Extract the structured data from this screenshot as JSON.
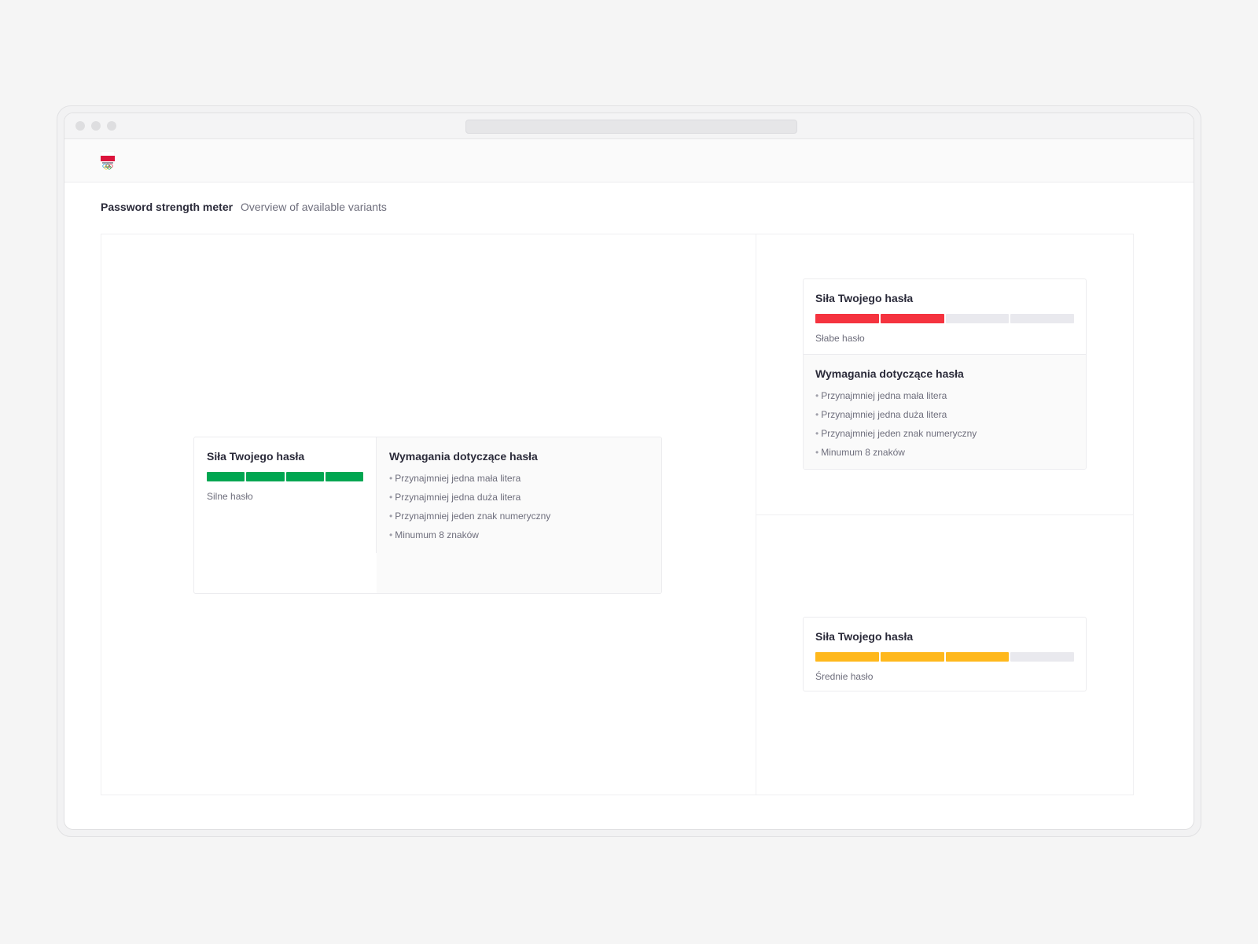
{
  "page": {
    "title": "Password strength meter",
    "subtitle": "Overview of available variants"
  },
  "logo": {
    "icon": "poland-olympic-logo"
  },
  "colors": {
    "strong": "#00a651",
    "weak": "#f5333f",
    "medium": "#ffb81c",
    "empty": "#e9e9ee"
  },
  "variants": {
    "horizontal": {
      "title": "Siła Twojego hasła",
      "strength_label": "Silne hasło",
      "strength_level": 4,
      "strength_max": 4,
      "level_color": "strong",
      "requirements_title": "Wymagania dotyczące hasła",
      "requirements": [
        "Przynajmniej jedna mała litera",
        "Przynajmniej jedna duża litera",
        "Przynajmniej jeden znak numeryczny",
        "Minumum 8 znaków"
      ]
    },
    "vertical": {
      "title": "Siła Twojego hasła",
      "strength_label": "Słabe hasło",
      "strength_level": 2,
      "strength_max": 4,
      "level_color": "weak",
      "requirements_title": "Wymagania dotyczące hasła",
      "requirements": [
        "Przynajmniej jedna mała litera",
        "Przynajmniej jedna duża litera",
        "Przynajmniej jeden znak numeryczny",
        "Minumum 8 znaków"
      ]
    },
    "simple": {
      "title": "Siła Twojego hasła",
      "strength_label": "Średnie hasło",
      "strength_level": 3,
      "strength_max": 4,
      "level_color": "medium"
    }
  }
}
